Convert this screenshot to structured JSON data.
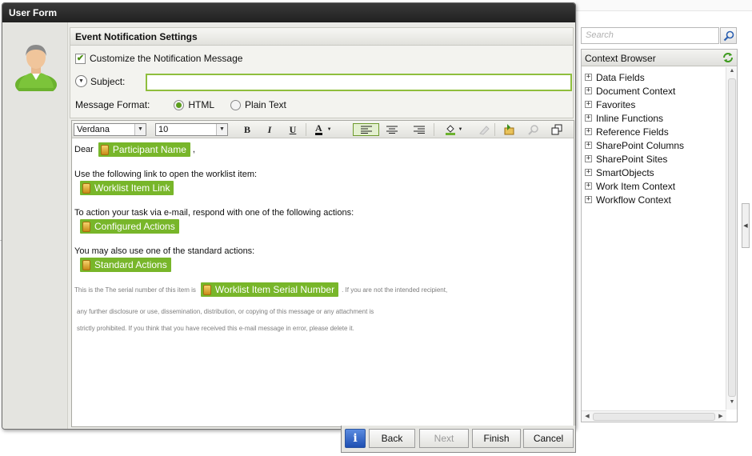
{
  "window": {
    "title": "User Form"
  },
  "settings": {
    "header": "Event Notification Settings",
    "customize_label": "Customize the Notification Message",
    "customize_checked": true,
    "subject_label": "Subject:",
    "subject_value": "",
    "format_label": "Message Format:",
    "format_html": "HTML",
    "format_plain": "Plain Text",
    "format_selected": "HTML"
  },
  "toolbar": {
    "font": "Verdana",
    "size": "10",
    "bold": "B",
    "italic": "I",
    "underline": "U",
    "font_color": "A"
  },
  "message": {
    "dear": "Dear",
    "participant_field": "Participant Name",
    "comma": ",",
    "link_intro": "Use the following link to open the worklist item:",
    "worklist_link_field": "Worklist Item Link",
    "action_intro": "To action your task via e-mail, respond with one of the following actions:",
    "configured_actions_field": "Configured Actions",
    "standard_intro": "You may also use one of the standard actions:",
    "standard_actions_field": "Standard Actions",
    "serial_pre": "This is the The serial number of this item is",
    "serial_field": "Worklist Item Serial Number",
    "serial_post": ". If you are not the intended recipient,",
    "disclaimer_2": "any further disclosure or use, dissemination, distribution, or copying of this message or any attachment is",
    "disclaimer_3": "strictly prohibited. If you think that you have received this e-mail message in error, please delete it."
  },
  "buttons": {
    "info": "i",
    "back": "Back",
    "next": "Next",
    "finish": "Finish",
    "cancel": "Cancel"
  },
  "search": {
    "placeholder": "Search"
  },
  "context_browser": {
    "title": "Context Browser",
    "items": [
      "Data Fields",
      "Document Context",
      "Favorites",
      "Inline Functions",
      "Reference Fields",
      "SharePoint Columns",
      "SharePoint Sites",
      "SmartObjects",
      "Work Item Context",
      "Workflow Context"
    ]
  },
  "colors": {
    "accent_green": "#78b62a",
    "titlebar": "#2a2a2a",
    "info_blue": "#1e4fb2"
  }
}
